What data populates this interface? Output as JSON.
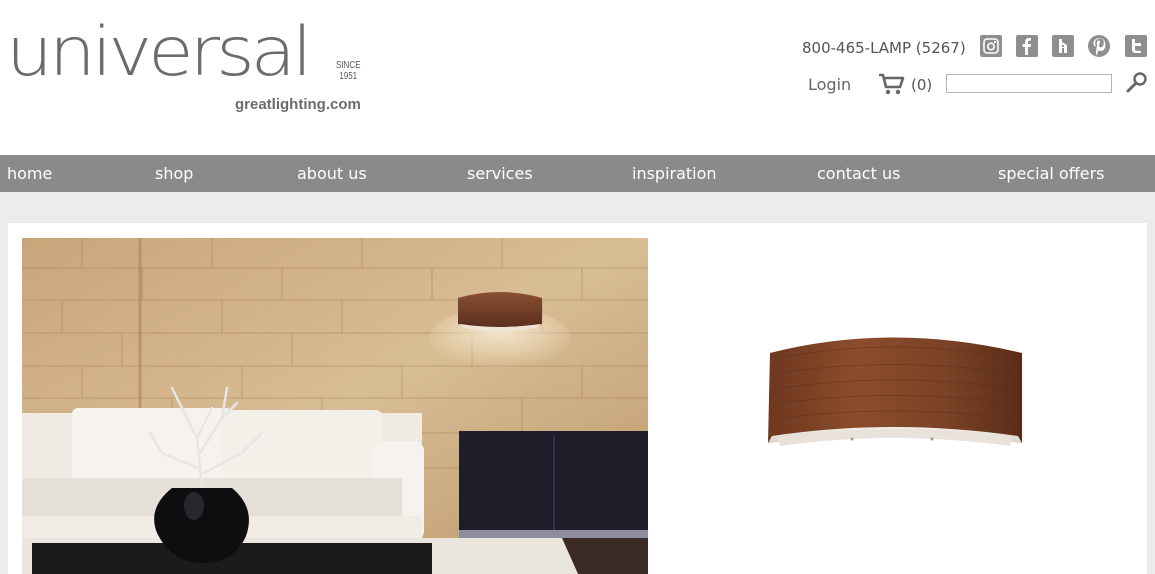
{
  "brand": {
    "wordmark": "universal",
    "since_line1": "SINCE",
    "since_line2": "1951",
    "domain": "greatlighting.com"
  },
  "topbar": {
    "phone": "800-465-LAMP (5267)",
    "social": [
      {
        "name": "instagram-icon",
        "glyph": "◙"
      },
      {
        "name": "facebook-icon",
        "glyph": "f"
      },
      {
        "name": "houzz-icon",
        "glyph": "h"
      },
      {
        "name": "pinterest-icon",
        "glyph": "p"
      },
      {
        "name": "twitter-icon",
        "glyph": "t"
      }
    ],
    "login_label": "Login",
    "cart_count": "(0)",
    "search_placeholder": ""
  },
  "nav": {
    "items": [
      "home",
      "shop",
      "about us",
      "services",
      "inspiration",
      "contact us",
      "special offers"
    ]
  },
  "colors": {
    "nav_bg": "#8a8a8a",
    "content_bg": "#ececec",
    "logo_gray": "#6b6b6b",
    "icon_gray": "#8e8e8e"
  }
}
